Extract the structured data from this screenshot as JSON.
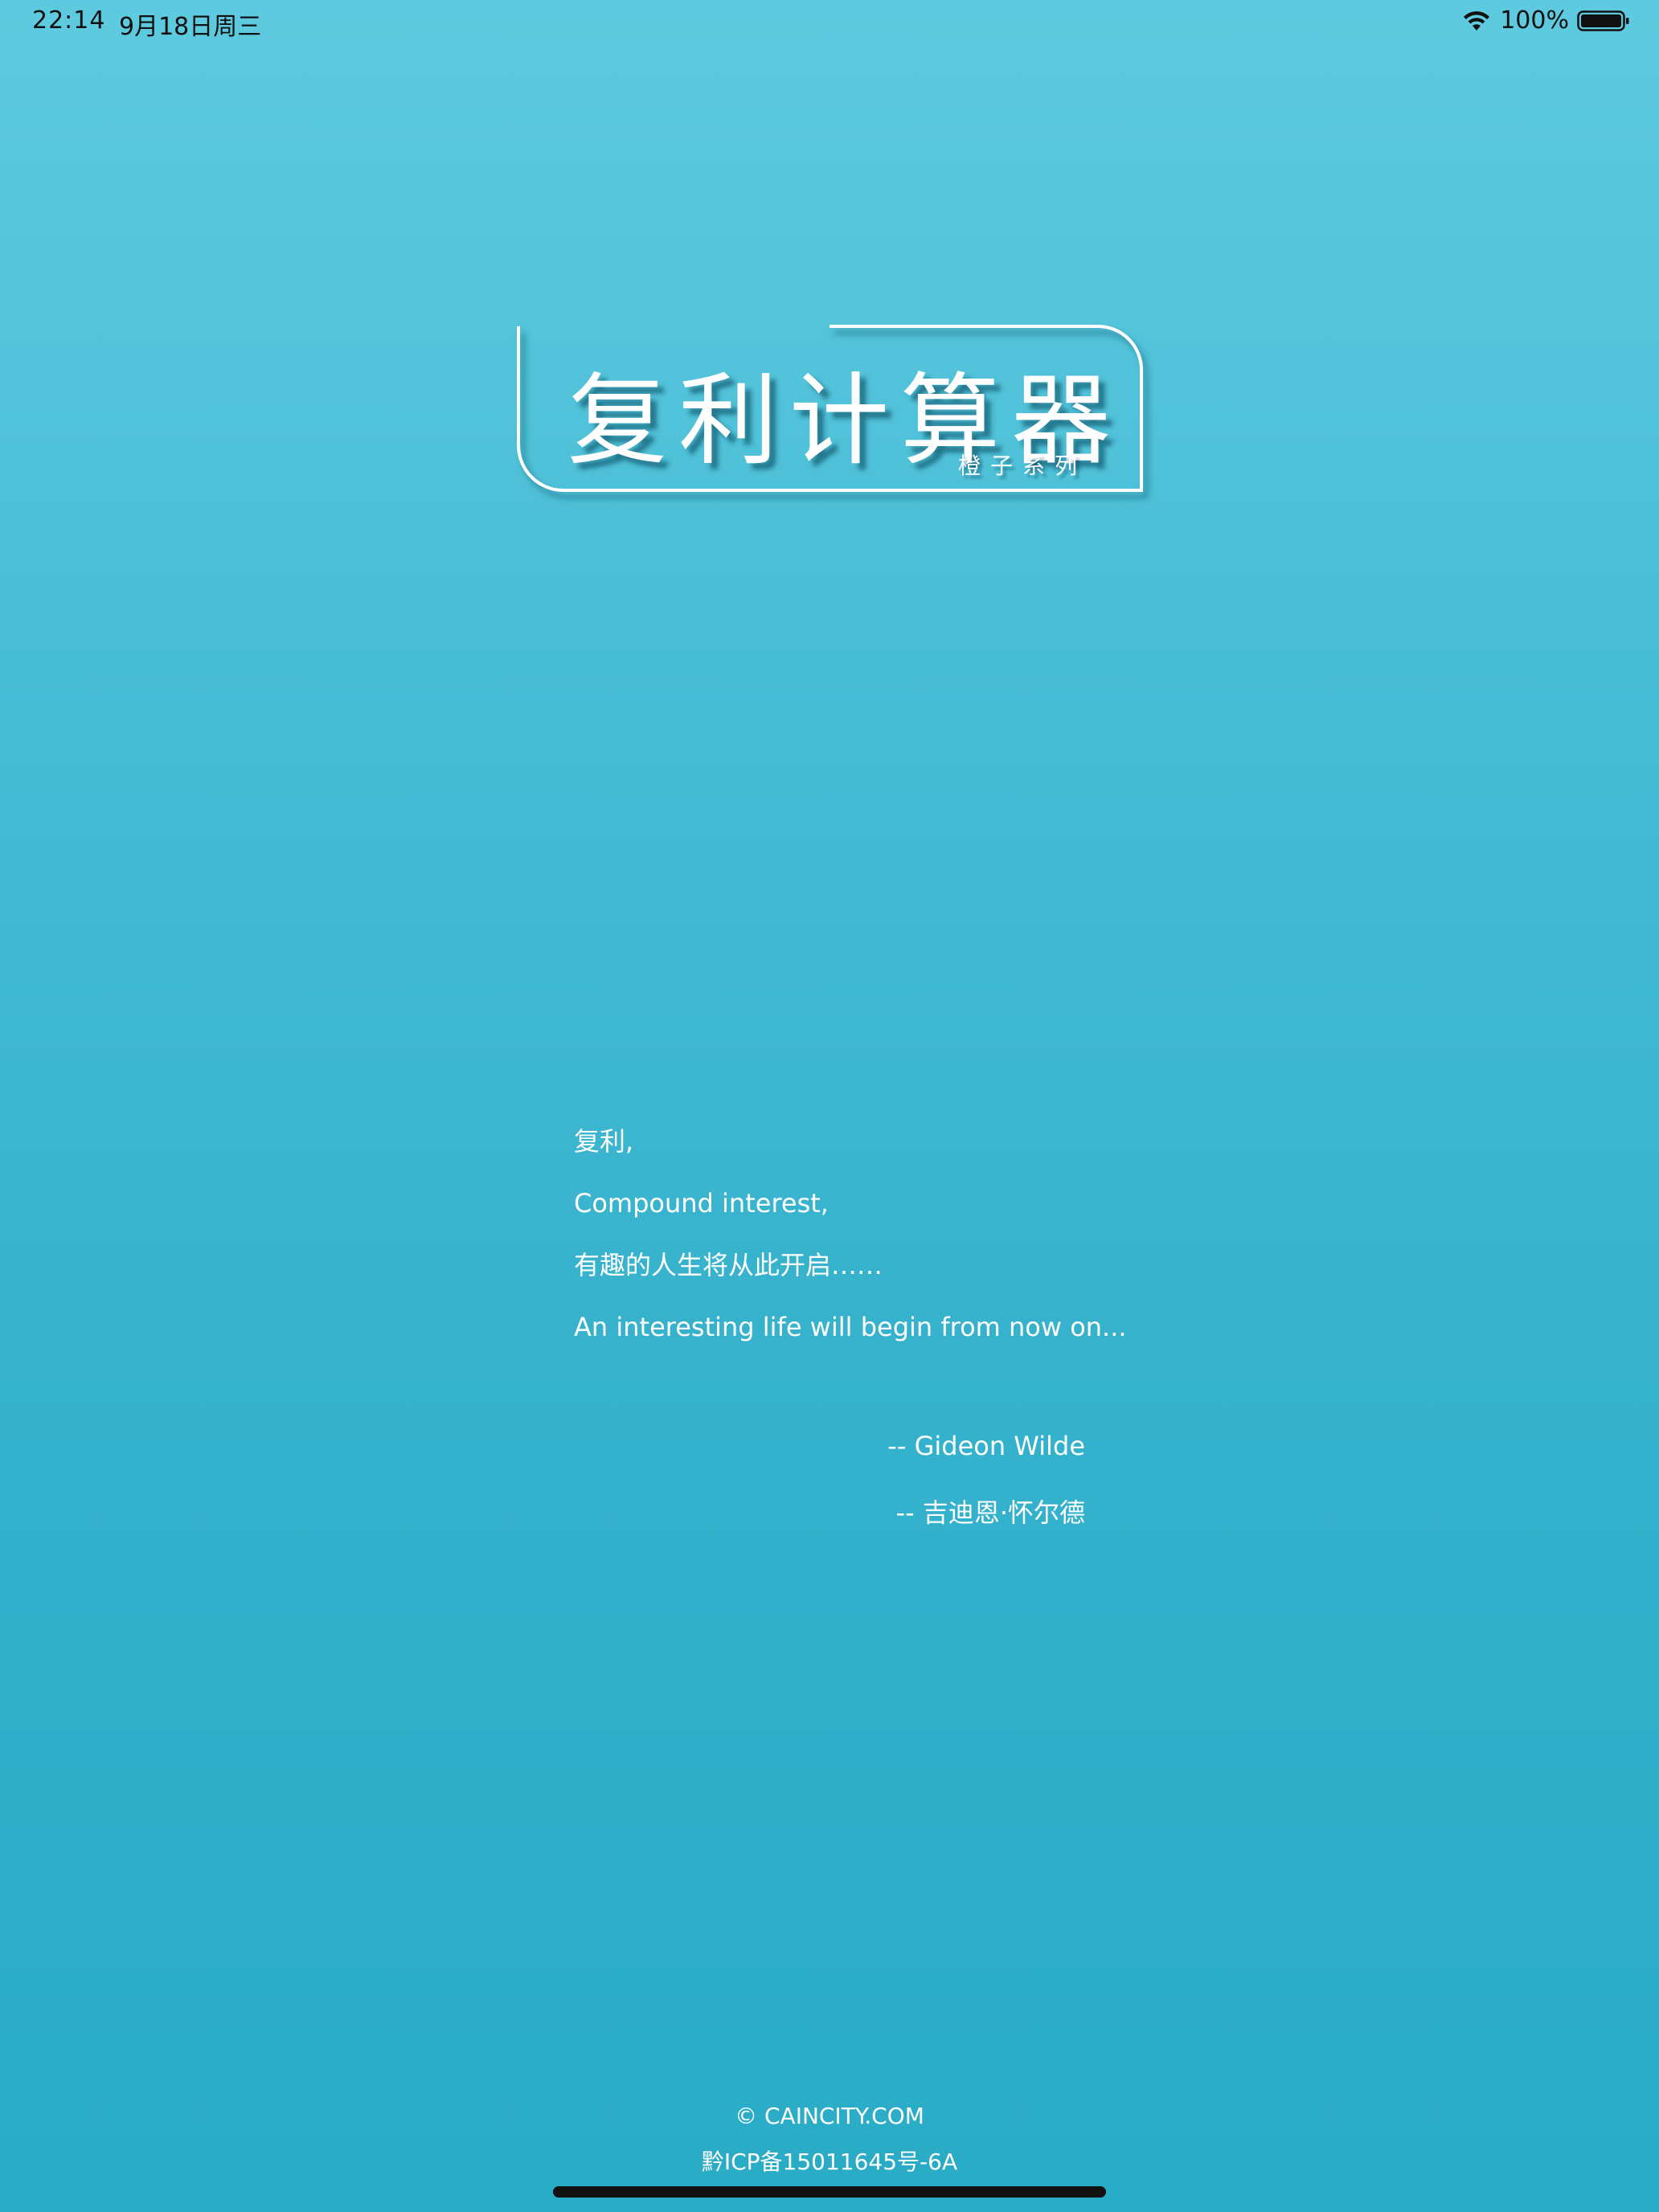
{
  "status_bar": {
    "time": "22:14",
    "date": "9月18日周三",
    "battery_percent": "100%",
    "battery_level": 1.0,
    "icons": [
      "wifi-icon",
      "battery-icon"
    ]
  },
  "logo": {
    "title": "复利计算器",
    "subtitle": "橙子系列"
  },
  "quote": {
    "lines": [
      "复利,",
      "Compound interest,",
      "有趣的人生将从此开启……",
      "An interesting life will begin from now on..."
    ],
    "attribution_en": "-- Gideon Wilde",
    "attribution_cn": "-- 吉迪恩·怀尔德"
  },
  "footer": {
    "copyright": "© CAINCITY.COM",
    "icp": "黔ICP备15011645号-6A"
  },
  "colors": {
    "background_top": "#5ECADF",
    "background_bottom": "#2AACC6",
    "text": "#FFFFFF",
    "status_text": "#111111"
  }
}
